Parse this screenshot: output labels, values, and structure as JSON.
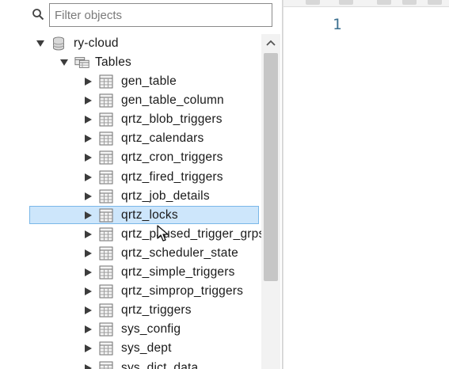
{
  "navigator": {
    "filter": {
      "placeholder": "Filter objects",
      "value": ""
    },
    "database": {
      "name": "ry-cloud",
      "expanded": true,
      "icon": "database-icon"
    },
    "folder": {
      "name": "Tables",
      "expanded": true,
      "icon": "folder-icon"
    },
    "tables": [
      "gen_table",
      "gen_table_column",
      "qrtz_blob_triggers",
      "qrtz_calendars",
      "qrtz_cron_triggers",
      "qrtz_fired_triggers",
      "qrtz_job_details",
      "qrtz_locks",
      "qrtz_paused_trigger_grps",
      "qrtz_scheduler_state",
      "qrtz_simple_triggers",
      "qrtz_simprop_triggers",
      "qrtz_triggers",
      "sys_config",
      "sys_dept",
      "sys_dict_data"
    ],
    "selected_table": "qrtz_locks"
  },
  "editor": {
    "line_numbers": [
      "1"
    ]
  },
  "colors": {
    "selection_bg": "#cde6fb",
    "selection_border": "#7ab7e8",
    "line_number": "#3a6f8f",
    "arrow": "#3c3c3c"
  }
}
